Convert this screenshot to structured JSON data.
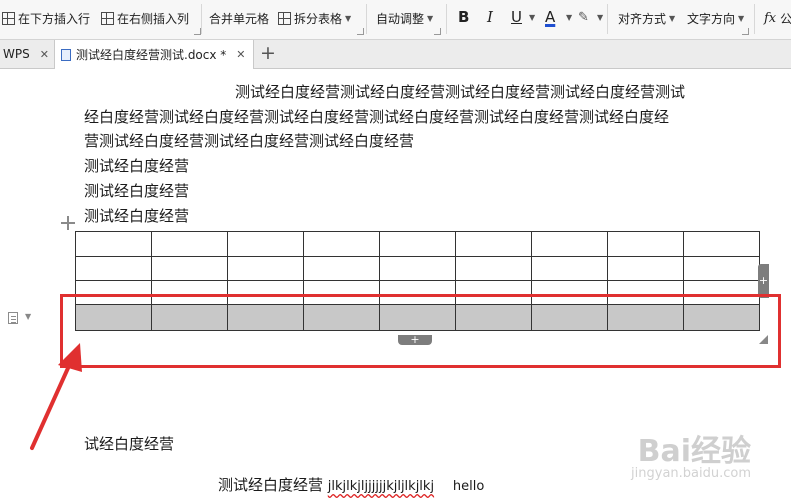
{
  "ribbon": {
    "insert_below": "在下方插入行",
    "insert_right": "在右侧插入列",
    "merge_cells": "合并单元格",
    "split_table": "拆分表格",
    "auto_adjust": "自动调整",
    "bold": "B",
    "italic": "I",
    "underline": "U",
    "font_color": "A",
    "align": "对齐方式",
    "text_direction": "文字方向",
    "fx": "fx",
    "fx_tail": "公"
  },
  "tabs": [
    {
      "label": "WPS"
    },
    {
      "label": "测试经白度经营测试.docx *"
    }
  ],
  "document": {
    "para1_line1": "测试经白度经营测试经白度经营测试经白度经营测试经白度经营测试",
    "para1_line2": "经白度经营测试经白度经营测试经白度经营测试经白度经营测试经白度经营测试经白度经",
    "para1_line3": "营测试经白度经营测试经白度经营测试经白度经营",
    "line4": "测试经白度经营",
    "line5": "测试经白度经营",
    "line6": "测试经白度经营",
    "line_after_table": "试经白度经营",
    "last_line_chinese": "测试经白度经营",
    "last_line_latin": "jlkjlkjljjjjjjkjljlkjlkj",
    "last_line_hello": "hello"
  },
  "table": {
    "rows": 4,
    "cols": 9,
    "selected_row_index": 3
  },
  "watermark": {
    "logo": "Bai经验",
    "url": "jingyan.baidu.com"
  },
  "colors": {
    "highlight_box": "#e03030",
    "arrow": "#e03030",
    "selected_row": "#c8c8c8"
  }
}
